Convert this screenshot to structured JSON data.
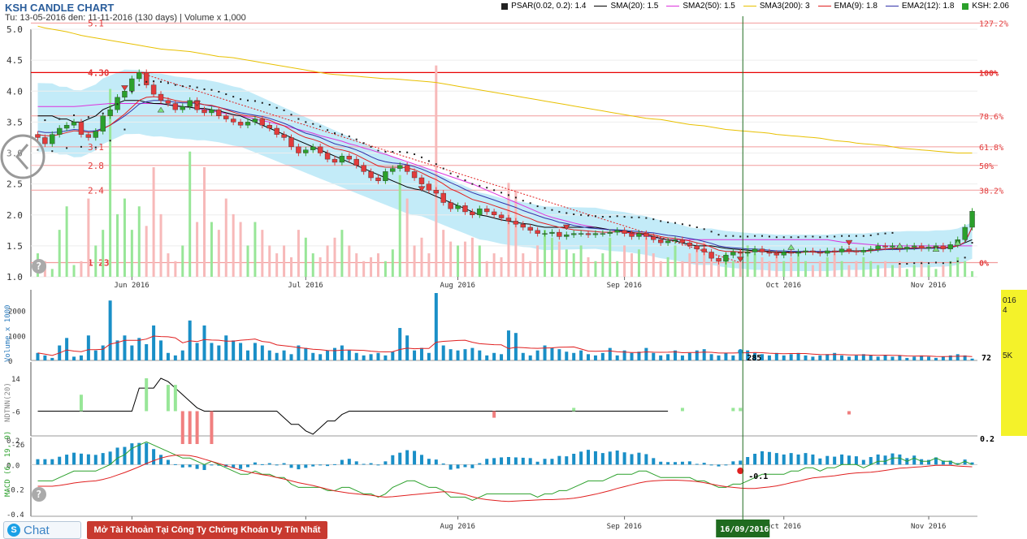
{
  "header": {
    "title": "KSH CANDLE CHART",
    "subtitle": "Tu: 13-05-2016 den: 11-11-2016 (130 days) | Volume x 1,000"
  },
  "legend": [
    {
      "label": "PSAR(0.02, 0.2): 1.4",
      "kind": "square",
      "color": "#222222"
    },
    {
      "label": "SMA(20): 1.5",
      "kind": "line",
      "color": "#000000"
    },
    {
      "label": "SMA2(50): 1.5",
      "kind": "line",
      "color": "#dd33dd"
    },
    {
      "label": "SMA3(200): 3",
      "kind": "line",
      "color": "#e8c000"
    },
    {
      "label": "EMA(9): 1.8",
      "kind": "line",
      "color": "#e02020"
    },
    {
      "label": "EMA2(12): 1.8",
      "kind": "line",
      "color": "#3333aa"
    },
    {
      "label": "KSH: 2.06",
      "kind": "square",
      "color": "#2ba02b"
    }
  ],
  "colors": {
    "up": "#2ba02b",
    "down": "#e23b3b",
    "vol_up": "#98e698",
    "vol_down": "#f7b9b9",
    "band": "#bde9f7",
    "fib": "#e23b3b",
    "vol_bar": "#1a8fc7",
    "cursor": "#1f6b1f"
  },
  "chart_data": {
    "type": "candlestick",
    "x_ticks": [
      "Jun 2016",
      "Jul 2016",
      "Aug 2016",
      "Sep 2016",
      "Oct 2016",
      "Nov 2016"
    ],
    "cursor_label": "16/09/2016",
    "price_panel": {
      "ylim": [
        1.0,
        5.0
      ],
      "y_ticks": [
        "5.0",
        "4.5",
        "4.0",
        "3.5",
        "3.0",
        "2.5",
        "2.0",
        "1.5",
        "1.0"
      ],
      "fib_levels": [
        {
          "price_label": "5.1",
          "pct": "127.2%",
          "value": 5.1
        },
        {
          "price_label": "4.30",
          "pct": "100%",
          "value": 4.3
        },
        {
          "price_label": "",
          "pct": "78.6%",
          "value": 3.6
        },
        {
          "price_label": "3.1",
          "pct": "61.8%",
          "value": 3.1
        },
        {
          "price_label": "2.8",
          "pct": "50%",
          "value": 2.8
        },
        {
          "price_label": "2.4",
          "pct": "38.2%",
          "value": 2.4
        },
        {
          "price_label": "1.23",
          "pct": "0%",
          "value": 1.23
        }
      ],
      "close": [
        3.25,
        3.15,
        3.3,
        3.4,
        3.45,
        3.5,
        3.3,
        3.25,
        3.35,
        3.6,
        3.7,
        3.9,
        4.0,
        4.2,
        4.3,
        4.1,
        3.95,
        3.85,
        3.8,
        3.7,
        3.75,
        3.85,
        3.7,
        3.65,
        3.7,
        3.6,
        3.55,
        3.5,
        3.45,
        3.5,
        3.55,
        3.45,
        3.4,
        3.3,
        3.25,
        3.1,
        3.0,
        3.05,
        3.1,
        3.0,
        2.9,
        2.85,
        2.95,
        2.9,
        2.8,
        2.7,
        2.6,
        2.55,
        2.7,
        2.75,
        2.8,
        2.7,
        2.6,
        2.5,
        2.4,
        2.35,
        2.2,
        2.1,
        2.15,
        2.05,
        2.0,
        2.1,
        2.05,
        2.0,
        1.95,
        1.9,
        1.85,
        1.8,
        1.75,
        1.7,
        1.7,
        1.72,
        1.65,
        1.68,
        1.7,
        1.7,
        1.68,
        1.7,
        1.7,
        1.72,
        1.75,
        1.7,
        1.65,
        1.7,
        1.65,
        1.6,
        1.55,
        1.58,
        1.6,
        1.55,
        1.5,
        1.45,
        1.4,
        1.3,
        1.25,
        1.35,
        1.4,
        1.38,
        1.4,
        1.45,
        1.4,
        1.38,
        1.35,
        1.4,
        1.38,
        1.4,
        1.42,
        1.4,
        1.38,
        1.42,
        1.4,
        1.45,
        1.42,
        1.4,
        1.43,
        1.45,
        1.5,
        1.48,
        1.5,
        1.45,
        1.48,
        1.5,
        1.46,
        1.48,
        1.5,
        1.45,
        1.52,
        1.6,
        1.8,
        2.06
      ],
      "sma20": [
        3.6,
        3.6,
        3.6,
        3.55,
        3.55,
        3.5,
        3.5,
        3.55,
        3.6,
        3.7,
        3.75,
        3.8,
        3.85,
        3.85,
        3.85,
        3.82,
        3.8,
        3.8,
        3.78,
        3.76,
        3.75,
        3.74,
        3.72,
        3.72,
        3.7,
        3.68,
        3.65,
        3.62,
        3.6,
        3.55,
        3.5,
        3.45,
        3.4,
        3.35,
        3.3,
        3.25,
        3.2,
        3.15,
        3.1,
        3.05,
        3.0,
        2.95,
        2.9,
        2.85,
        2.8,
        2.75,
        2.7,
        2.65,
        2.6,
        2.55,
        2.5,
        2.45,
        2.42,
        2.4,
        2.35,
        2.3,
        2.25,
        2.2,
        2.15,
        2.1,
        2.05,
        2.0,
        1.98,
        1.95,
        1.92,
        1.9,
        1.88,
        1.86,
        1.85,
        1.82,
        1.8,
        1.8,
        1.8,
        1.8,
        1.8,
        1.8,
        1.8,
        1.8,
        1.78,
        1.76,
        1.75,
        1.74,
        1.72,
        1.7,
        1.68,
        1.65,
        1.62,
        1.6,
        1.58,
        1.55,
        1.52,
        1.5,
        1.5,
        1.5,
        1.48,
        1.46,
        1.45,
        1.44,
        1.43,
        1.42,
        1.42,
        1.41,
        1.4,
        1.4,
        1.4,
        1.4,
        1.4,
        1.4,
        1.4,
        1.4,
        1.41,
        1.42,
        1.42,
        1.42,
        1.42,
        1.43,
        1.44,
        1.45,
        1.45,
        1.45,
        1.46,
        1.46,
        1.46,
        1.46,
        1.47,
        1.47,
        1.48,
        1.5,
        1.55,
        1.6
      ],
      "sma50": [
        3.75,
        3.75,
        3.75,
        3.75,
        3.75,
        3.75,
        3.76,
        3.77,
        3.78,
        3.79,
        3.8,
        3.8,
        3.8,
        3.8,
        3.8,
        3.8,
        3.8,
        3.79,
        3.78,
        3.77,
        3.75,
        3.74,
        3.72,
        3.7,
        3.68,
        3.66,
        3.64,
        3.62,
        3.6,
        3.58,
        3.55,
        3.52,
        3.5,
        3.47,
        3.44,
        3.41,
        3.38,
        3.35,
        3.32,
        3.28,
        3.25,
        3.22,
        3.19,
        3.15,
        3.12,
        3.08,
        3.05,
        3.01,
        2.98,
        2.94,
        2.9,
        2.86,
        2.82,
        2.78,
        2.74,
        2.7,
        2.66,
        2.62,
        2.58,
        2.54,
        2.5,
        2.45,
        2.4,
        2.35,
        2.3,
        2.25,
        2.2,
        2.15,
        2.1,
        2.05,
        2.0,
        1.96,
        1.93,
        1.9,
        1.87,
        1.84,
        1.82,
        1.8,
        1.78,
        1.76,
        1.74,
        1.72,
        1.7,
        1.68,
        1.66,
        1.64,
        1.62,
        1.6,
        1.6,
        1.6,
        1.6,
        1.6,
        1.6,
        1.6,
        1.6,
        1.6,
        1.6,
        1.6,
        1.6,
        1.6,
        1.6,
        1.6,
        1.6,
        1.6,
        1.6,
        1.6,
        1.6,
        1.6,
        1.6,
        1.6,
        1.58,
        1.56,
        1.55,
        1.54,
        1.53,
        1.52,
        1.51,
        1.5,
        1.5,
        1.5,
        1.5,
        1.5,
        1.5,
        1.5,
        1.5,
        1.5,
        1.5,
        1.5,
        1.5,
        1.5
      ],
      "sma200": [
        5.05,
        5.02,
        5.0,
        4.98,
        4.96,
        4.93,
        4.9,
        4.88,
        4.86,
        4.84,
        4.82,
        4.8,
        4.78,
        4.76,
        4.74,
        4.72,
        4.7,
        4.68,
        4.67,
        4.66,
        4.65,
        4.64,
        4.62,
        4.6,
        4.58,
        4.56,
        4.55,
        4.54,
        4.52,
        4.5,
        4.48,
        4.46,
        4.44,
        4.42,
        4.4,
        4.38,
        4.36,
        4.34,
        4.32,
        4.3,
        4.28,
        4.27,
        4.26,
        4.25,
        4.24,
        4.23,
        4.22,
        4.21,
        4.2,
        4.2,
        4.19,
        4.18,
        4.17,
        4.16,
        4.15,
        4.14,
        4.12,
        4.1,
        4.08,
        4.06,
        4.04,
        4.02,
        4.0,
        3.98,
        3.96,
        3.94,
        3.92,
        3.9,
        3.88,
        3.86,
        3.84,
        3.82,
        3.8,
        3.78,
        3.76,
        3.74,
        3.72,
        3.7,
        3.68,
        3.66,
        3.64,
        3.62,
        3.6,
        3.58,
        3.56,
        3.55,
        3.54,
        3.52,
        3.5,
        3.48,
        3.46,
        3.45,
        3.44,
        3.42,
        3.4,
        3.38,
        3.37,
        3.36,
        3.35,
        3.34,
        3.33,
        3.32,
        3.3,
        3.29,
        3.28,
        3.27,
        3.26,
        3.25,
        3.24,
        3.22,
        3.2,
        3.19,
        3.18,
        3.16,
        3.15,
        3.14,
        3.13,
        3.12,
        3.1,
        3.08,
        3.07,
        3.06,
        3.05,
        3.04,
        3.03,
        3.02,
        3.01,
        3.0,
        3.0,
        3.0
      ],
      "ema9": [
        3.3,
        3.28,
        3.28,
        3.3,
        3.33,
        3.36,
        3.35,
        3.33,
        3.34,
        3.39,
        3.45,
        3.54,
        3.63,
        3.74,
        3.85,
        3.9,
        3.91,
        3.9,
        3.88,
        3.85,
        3.83,
        3.83,
        3.81,
        3.78,
        3.77,
        3.74,
        3.7,
        3.66,
        3.62,
        3.6,
        3.59,
        3.56,
        3.53,
        3.48,
        3.44,
        3.37,
        3.3,
        3.25,
        3.22,
        3.18,
        3.12,
        3.07,
        3.05,
        3.02,
        2.97,
        2.91,
        2.85,
        2.79,
        2.77,
        2.77,
        2.77,
        2.76,
        2.73,
        2.68,
        2.62,
        2.57,
        2.5,
        2.42,
        2.37,
        2.31,
        2.25,
        2.22,
        2.19,
        2.15,
        2.11,
        2.07,
        2.03,
        1.98,
        1.94,
        1.89,
        1.86,
        1.83,
        1.8,
        1.78,
        1.76,
        1.75,
        1.74,
        1.73,
        1.72,
        1.72,
        1.73,
        1.72,
        1.71,
        1.71,
        1.7,
        1.68,
        1.65,
        1.63,
        1.62,
        1.6,
        1.58,
        1.55,
        1.52,
        1.48,
        1.43,
        1.41,
        1.41,
        1.4,
        1.4,
        1.41,
        1.41,
        1.4,
        1.39,
        1.39,
        1.39,
        1.39,
        1.4,
        1.4,
        1.39,
        1.4,
        1.4,
        1.41,
        1.41,
        1.41,
        1.41,
        1.42,
        1.44,
        1.45,
        1.46,
        1.46,
        1.46,
        1.47,
        1.47,
        1.47,
        1.48,
        1.47,
        1.48,
        1.5,
        1.56,
        1.8
      ],
      "ema12": [
        3.35,
        3.33,
        3.33,
        3.34,
        3.36,
        3.38,
        3.37,
        3.35,
        3.36,
        3.4,
        3.45,
        3.52,
        3.6,
        3.69,
        3.79,
        3.83,
        3.85,
        3.85,
        3.84,
        3.82,
        3.81,
        3.81,
        3.8,
        3.78,
        3.76,
        3.74,
        3.71,
        3.68,
        3.65,
        3.63,
        3.61,
        3.59,
        3.56,
        3.52,
        3.48,
        3.43,
        3.37,
        3.32,
        3.29,
        3.25,
        3.2,
        3.15,
        3.12,
        3.09,
        3.05,
        3.0,
        2.94,
        2.89,
        2.86,
        2.84,
        2.83,
        2.81,
        2.78,
        2.74,
        2.69,
        2.64,
        2.58,
        2.52,
        2.47,
        2.41,
        2.36,
        2.32,
        2.28,
        2.24,
        2.2,
        2.16,
        2.12,
        2.07,
        2.03,
        1.99,
        1.95,
        1.92,
        1.88,
        1.86,
        1.83,
        1.81,
        1.79,
        1.78,
        1.77,
        1.76,
        1.76,
        1.75,
        1.74,
        1.73,
        1.72,
        1.71,
        1.69,
        1.67,
        1.66,
        1.64,
        1.62,
        1.6,
        1.57,
        1.54,
        1.5,
        1.48,
        1.47,
        1.46,
        1.45,
        1.45,
        1.44,
        1.43,
        1.42,
        1.42,
        1.41,
        1.41,
        1.41,
        1.41,
        1.41,
        1.41,
        1.41,
        1.41,
        1.41,
        1.41,
        1.42,
        1.42,
        1.43,
        1.44,
        1.44,
        1.44,
        1.45,
        1.45,
        1.46,
        1.46,
        1.46,
        1.46,
        1.47,
        1.5,
        1.55,
        1.8
      ]
    },
    "volume_panel": {
      "y_label": "Volume x 1000",
      "y_ticks": [
        "2000",
        "1000",
        "0"
      ],
      "last_label": "72",
      "cursor_value": "285",
      "values": [
        300,
        200,
        100,
        600,
        900,
        150,
        200,
        1000,
        400,
        600,
        2400,
        800,
        1000,
        600,
        900,
        650,
        1400,
        800,
        300,
        200,
        400,
        1600,
        700,
        1400,
        700,
        600,
        1000,
        800,
        700,
        400,
        700,
        600,
        400,
        300,
        400,
        250,
        600,
        500,
        300,
        250,
        400,
        500,
        600,
        400,
        300,
        200,
        250,
        300,
        200,
        350,
        1300,
        1000,
        400,
        500,
        300,
        2700,
        600,
        450,
        400,
        450,
        500,
        400,
        200,
        300,
        250,
        1200,
        1100,
        300,
        200,
        400,
        600,
        500,
        450,
        350,
        300,
        400,
        250,
        200,
        300,
        500,
        200,
        400,
        300,
        350,
        500,
        300,
        200,
        250,
        400,
        200,
        300,
        400,
        450,
        250,
        200,
        300,
        200,
        350,
        400,
        300,
        250,
        200,
        300,
        200,
        250,
        300,
        200,
        150,
        200,
        250,
        300,
        200,
        150,
        200,
        250,
        200,
        150,
        200,
        150,
        200,
        100,
        150,
        200,
        150,
        100,
        150,
        200,
        250,
        200,
        72
      ]
    },
    "ntnn_panel": {
      "y_label": "NDTNN(20)",
      "y_ticks": [
        "14",
        "-6",
        "-26"
      ]
    },
    "macd_panel": {
      "y_label": "MACD (6, 19, 9)",
      "y_ticks": [
        "0.2",
        "0.0",
        "-0.2",
        "-0.4"
      ],
      "last_label": "0.2",
      "cursor_value": "-0.1"
    }
  },
  "footer": {
    "chat_label": "Chat",
    "open_account_label": "Mở Tài Khoản Tại Công Ty Chứng Khoán Uy Tín Nhất"
  },
  "side_panel": {
    "line1": "016",
    "line2": "4",
    "line3": "5K"
  }
}
